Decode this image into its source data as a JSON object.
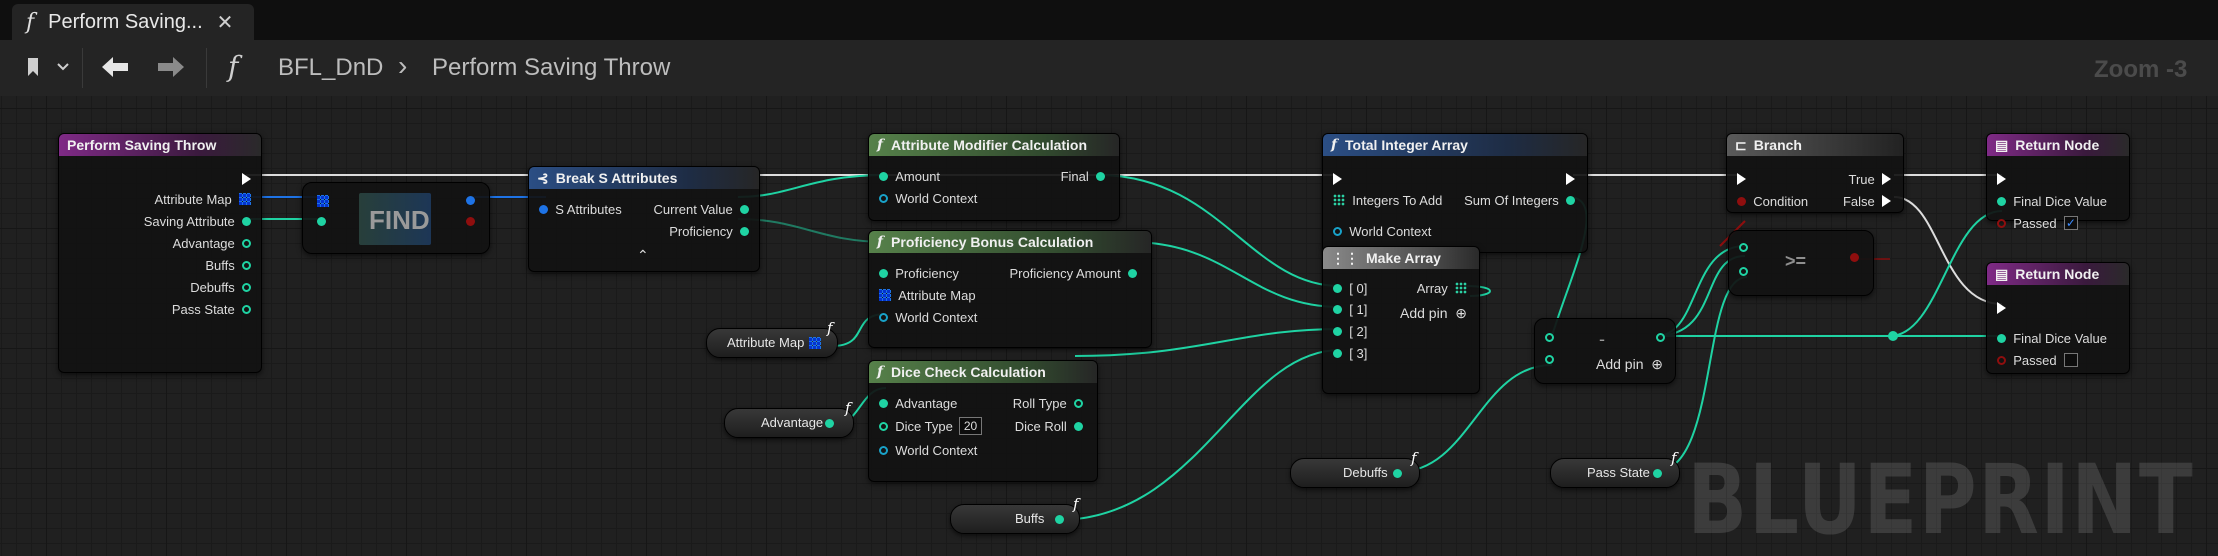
{
  "tab": {
    "icon": "f",
    "title": "Perform Saving...",
    "close": "✕"
  },
  "toolbar": {
    "fx_icon": "f",
    "breadcrumb_parent": "BFL_DnD",
    "breadcrumb_sep": "›",
    "breadcrumb_current": "Perform Saving Throw"
  },
  "graph": {
    "zoom": "Zoom -3",
    "watermark": "BLUEPRINT"
  },
  "nodes": {
    "entry": {
      "title": "Perform Saving Throw",
      "pins": [
        "Attribute Map",
        "Saving Attribute",
        "Advantage",
        "Buffs",
        "Debuffs",
        "Pass State"
      ]
    },
    "find": {
      "label": "FIND"
    },
    "break": {
      "title": "Break S Attributes",
      "in": "S Attributes",
      "out1": "Current Value",
      "out2": "Proficiency"
    },
    "attrmod": {
      "title": "Attribute Modifier Calculation",
      "in": "Amount",
      "out": "Final",
      "ctx": "World Context"
    },
    "profbonus": {
      "title": "Proficiency Bonus Calculation",
      "in1": "Proficiency",
      "in2": "Attribute Map",
      "out": "Proficiency Amount",
      "ctx": "World Context"
    },
    "dice": {
      "title": "Dice Check Calculation",
      "in1": "Advantage",
      "in2": "Dice Type",
      "dice_value": "20",
      "out1": "Roll Type",
      "out2": "Dice Roll",
      "ctx": "World Context"
    },
    "total": {
      "title": "Total Integer Array",
      "in": "Integers To Add",
      "out": "Sum Of Integers",
      "ctx": "World Context"
    },
    "makearray": {
      "title": "Make Array",
      "pins": [
        "[ 0]",
        "[ 1]",
        "[ 2]",
        "[ 3]"
      ],
      "out": "Array",
      "add": "Add pin"
    },
    "subtract": {
      "op": "-",
      "add": "Add pin"
    },
    "branch": {
      "title": "Branch",
      "in": "Condition",
      "t": "True",
      "f": "False"
    },
    "gte": {
      "op": ">="
    },
    "ret1": {
      "title": "Return Node",
      "p1": "Final Dice Value",
      "p2": "Passed",
      "passed_check": "✓"
    },
    "ret2": {
      "title": "Return Node",
      "p1": "Final Dice Value",
      "p2": "Passed"
    }
  },
  "getters": {
    "attribute_map": "Attribute Map",
    "advantage": "Advantage",
    "buffs": "Buffs",
    "debuffs": "Debuffs",
    "pass_state": "Pass State"
  },
  "colors": {
    "exec": "#ffffff",
    "int": "#1fd3a3",
    "struct": "#1e73e6",
    "bool": "#8f0e0e",
    "object": "#19a2c9",
    "float": "#1fd3a3",
    "function": "#7f2a86"
  }
}
